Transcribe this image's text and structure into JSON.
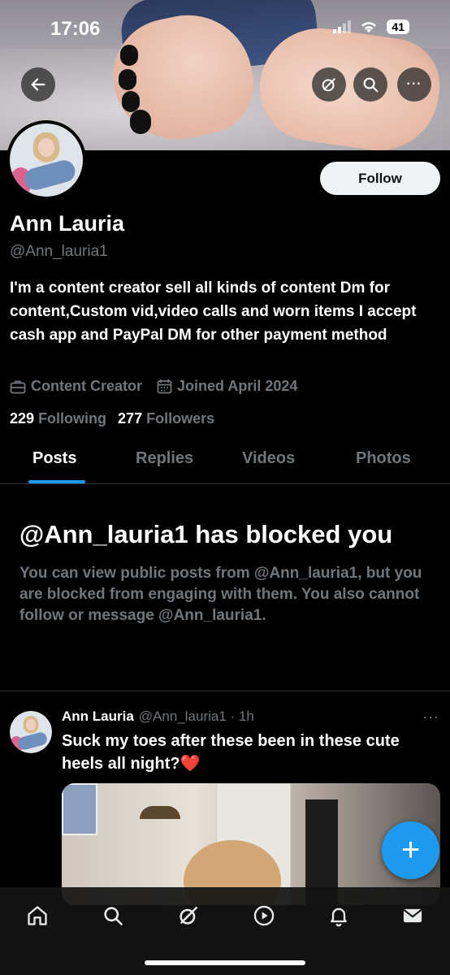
{
  "status_bar": {
    "time": "17:06",
    "battery": "41"
  },
  "header": {
    "back_label": "back",
    "more_label": "···"
  },
  "profile": {
    "name": "Ann Lauria",
    "handle": "@Ann_lauria1",
    "follow_label": "Follow",
    "bio": "I'm a content creator sell all kinds of content Dm for content,Custom vid,video calls and worn items I accept cash app and PayPal DM for other payment method",
    "category": "Content Creator",
    "joined": "Joined April 2024",
    "following_count": "229",
    "following_label": "Following",
    "followers_count": "277",
    "followers_label": "Followers"
  },
  "tabs": [
    {
      "label": "Posts",
      "active": true
    },
    {
      "label": "Replies",
      "active": false
    },
    {
      "label": "Videos",
      "active": false
    },
    {
      "label": "Photos",
      "active": false
    }
  ],
  "blocked": {
    "title": "@Ann_lauria1 has blocked you",
    "description": "You can view public posts from @Ann_lauria1, but you are blocked from engaging with them. You also cannot follow or message @Ann_lauria1."
  },
  "post": {
    "author": "Ann Lauria",
    "meta": "@Ann_lauria1 · 1h",
    "text": "Suck my toes after these been in these cute heels all night?",
    "emoji": "❤️"
  },
  "fab_label": "+",
  "colors": {
    "accent": "#1d9bf0",
    "muted": "#71767b",
    "background": "#000000"
  }
}
